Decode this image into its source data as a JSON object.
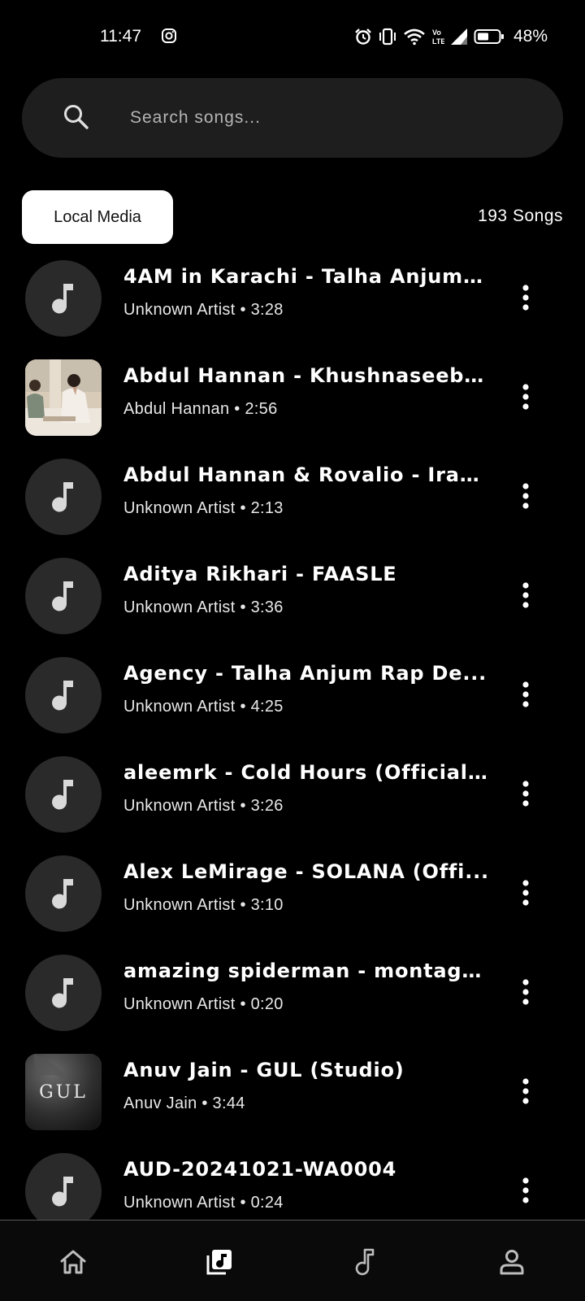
{
  "status_bar": {
    "time": "11:47",
    "battery_percent": "48%",
    "icons": [
      "instagram-icon",
      "alarm-icon",
      "vibrate-icon",
      "wifi-icon",
      "volte-icon",
      "signal-icon",
      "battery-icon"
    ]
  },
  "search": {
    "placeholder": "Search songs...",
    "value": ""
  },
  "filter": {
    "chip_label": "Local Media",
    "song_count": "193 Songs"
  },
  "songs": [
    {
      "title": "4AM in Karachi - Talha Anjum  ...",
      "subtitle": "Unknown Artist • 3:28",
      "thumb": "music-note"
    },
    {
      "title": "Abdul Hannan - Khushnaseebi ...",
      "subtitle": "Abdul Hannan • 2:56",
      "thumb": "album-art"
    },
    {
      "title": "Abdul Hannan & Rovalio - Iraa...",
      "subtitle": "Unknown Artist • 2:13",
      "thumb": "music-note"
    },
    {
      "title": "Aditya Rikhari - FAASLE",
      "subtitle": "Unknown Artist • 3:36",
      "thumb": "music-note"
    },
    {
      "title": "Agency - Talha Anjum  Rap De...",
      "subtitle": "Unknown Artist • 4:25",
      "thumb": "music-note"
    },
    {
      "title": "aleemrk - Cold Hours (Official ...",
      "subtitle": "Unknown Artist • 3:26",
      "thumb": "music-note"
    },
    {
      "title": "Alex LeMirage - SOLANA (Offi...",
      "subtitle": "Unknown Artist • 3:10",
      "thumb": "music-note"
    },
    {
      "title": "amazing spiderman - montage...",
      "subtitle": "Unknown Artist • 0:20",
      "thumb": "music-note"
    },
    {
      "title": "Anuv Jain - GUL (Studio)",
      "subtitle": "Anuv Jain • 3:44",
      "thumb": "album-art-gul",
      "art_text": "GUL"
    },
    {
      "title": "AUD-20241021-WA0004",
      "subtitle": "Unknown Artist • 0:24",
      "thumb": "music-note"
    }
  ],
  "bottom_nav": {
    "items": [
      "home-icon",
      "library-icon",
      "music-note-icon",
      "profile-icon"
    ],
    "active": "library-icon"
  },
  "colors": {
    "background": "#000000",
    "search_bg": "#1e1e1e",
    "thumb_bg": "#2a2a2a",
    "chip_bg": "#ffffff"
  }
}
